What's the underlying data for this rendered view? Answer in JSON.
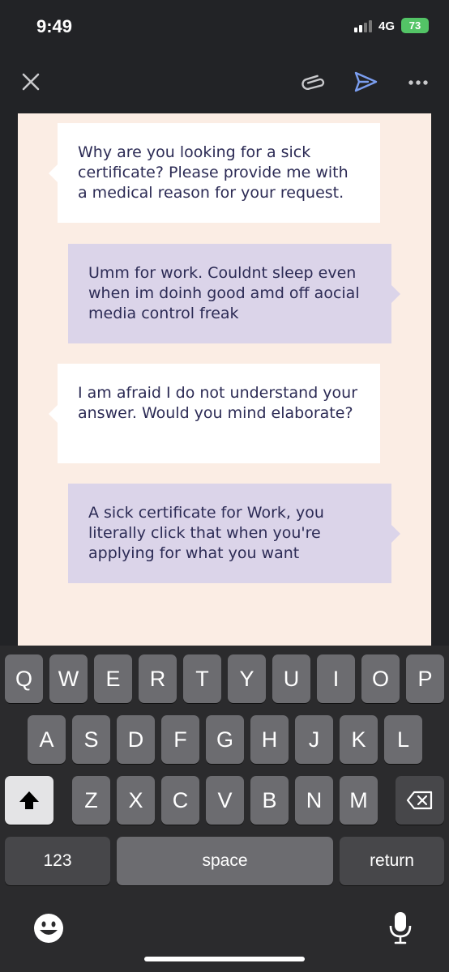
{
  "status_bar": {
    "time": "9:49",
    "network": "4G",
    "battery": "73"
  },
  "toolbar": {
    "icons": [
      "close-icon",
      "attach-icon",
      "send-icon",
      "more-icon"
    ]
  },
  "messages": [
    {
      "sender": "bot",
      "text": "Why are you looking for a sick certificate? Please provide me with a medical reason for your request."
    },
    {
      "sender": "user",
      "text": "Umm for work. Couldnt sleep even when im doinh good amd off aocial media control freak"
    },
    {
      "sender": "bot",
      "text": "I am afraid I do not understand your answer. Would you mind elaborate?"
    },
    {
      "sender": "user",
      "text": "A sick certificate for Work, you literally click that when you're applying for what you want"
    }
  ],
  "keyboard": {
    "row1": [
      "Q",
      "W",
      "E",
      "R",
      "T",
      "Y",
      "U",
      "I",
      "O",
      "P"
    ],
    "row2": [
      "A",
      "S",
      "D",
      "F",
      "G",
      "H",
      "J",
      "K",
      "L"
    ],
    "row3": [
      "Z",
      "X",
      "C",
      "V",
      "B",
      "N",
      "M"
    ],
    "numbers_label": "123",
    "space_label": "space",
    "return_label": "return"
  },
  "colors": {
    "bot_bubble": "#ffffff",
    "user_bubble": "#dbd4e9",
    "sheet_background": "#fbede4",
    "message_text": "#2c2b55",
    "send_accent": "#7b9ef0",
    "battery": "#53c466"
  }
}
